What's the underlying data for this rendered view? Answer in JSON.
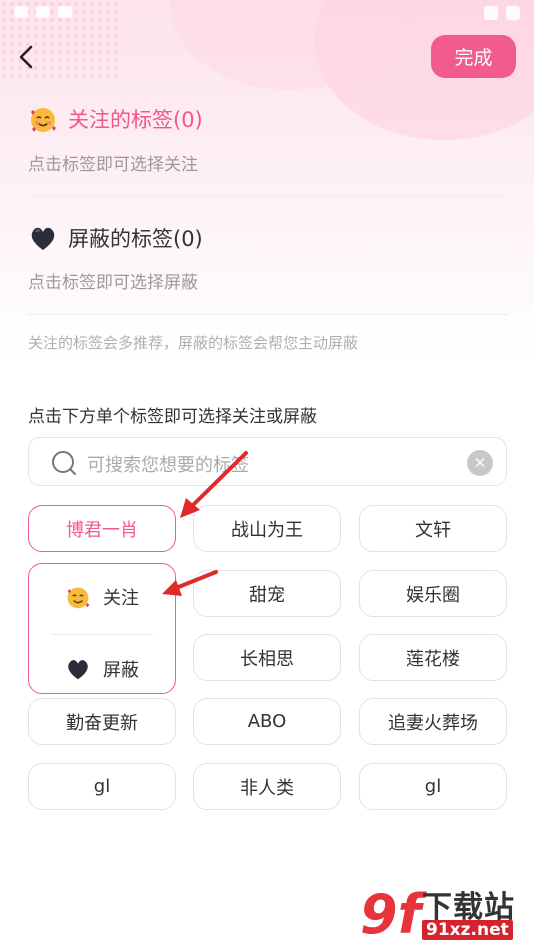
{
  "header": {
    "done_label": "完成"
  },
  "followed": {
    "title": "关注的标签(0)",
    "subtitle": "点击标签即可选择关注"
  },
  "blocked": {
    "title": "屏蔽的标签(0)",
    "subtitle": "点击标签即可选择屏蔽"
  },
  "hint": "关注的标签会多推荐，屏蔽的标签会帮您主动屏蔽",
  "instruction": "点击下方单个标签即可选择关注或屏蔽",
  "search": {
    "placeholder": "可搜索您想要的标签"
  },
  "tags": [
    "博君一肖",
    "战山为王",
    "文轩",
    "甜宠",
    "娱乐圈",
    "长相思",
    "莲花楼",
    "勤奋更新",
    "ABO",
    "追妻火葬场",
    "gl",
    "非人类",
    "gl"
  ],
  "popup": {
    "follow_label": "关注",
    "block_label": "屏蔽"
  },
  "watermark": {
    "logo": "9f",
    "text": "下载站",
    "url": "91xz.net"
  },
  "colors": {
    "accent": "#f25b8d",
    "muted_text": "#9a9a9a"
  }
}
